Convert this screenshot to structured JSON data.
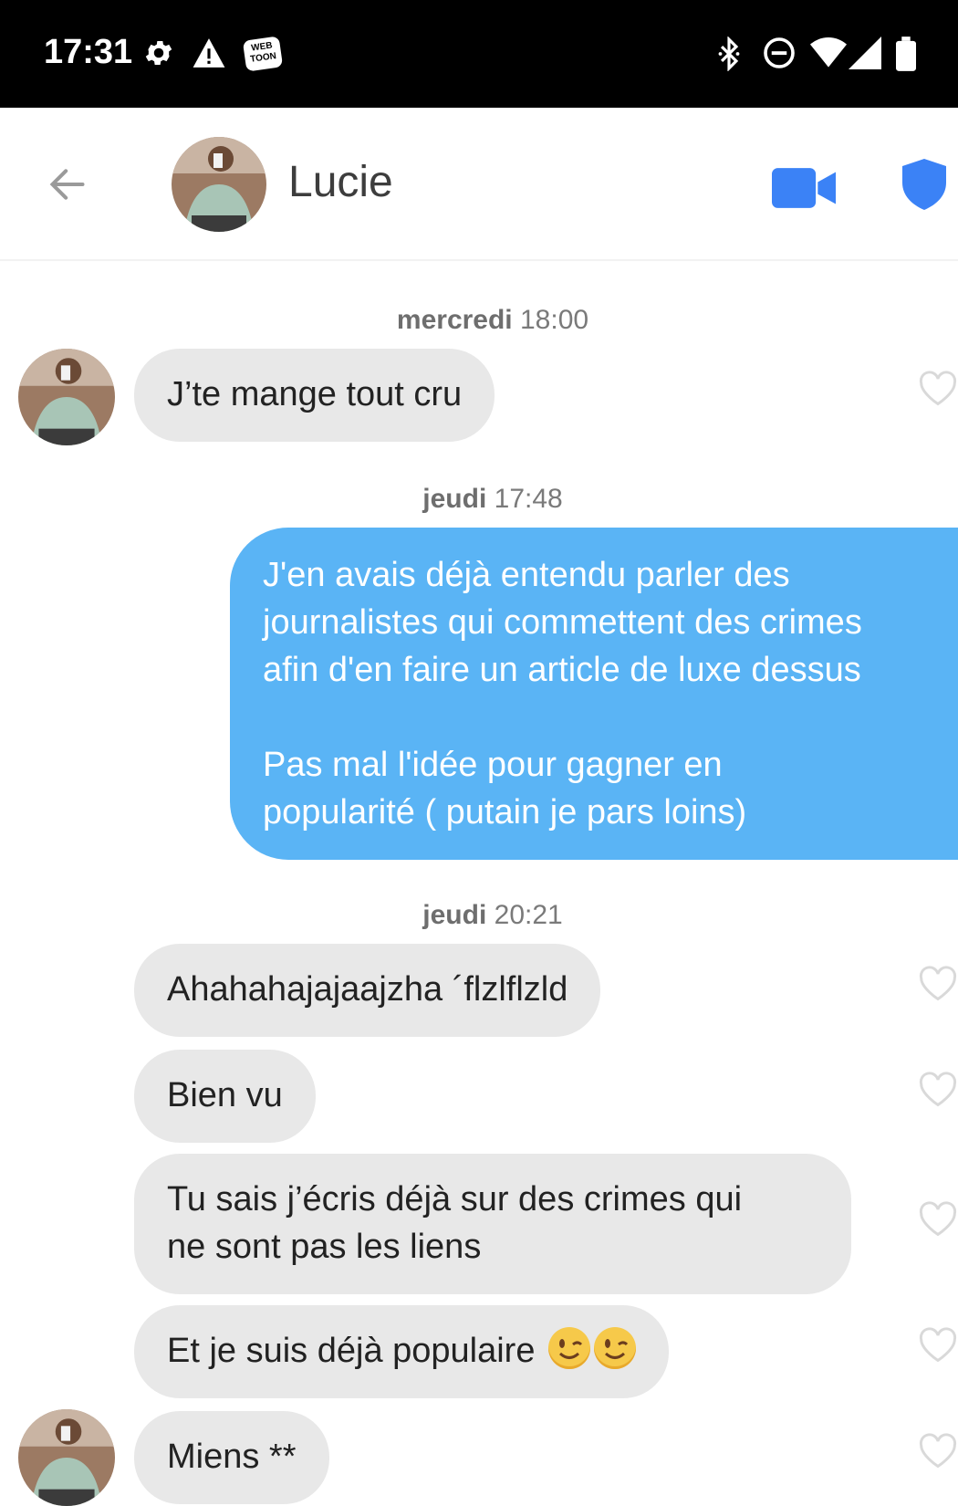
{
  "status_bar": {
    "time": "17:31",
    "left_icons": [
      "gear-icon",
      "warning-icon",
      "webtoon-icon"
    ],
    "webtoon_text": "WEB TOON",
    "right_icons": [
      "bluetooth-icon",
      "do-not-disturb-icon",
      "wifi-icon",
      "signal-icon",
      "battery-icon"
    ]
  },
  "header": {
    "contact_name": "Lucie",
    "icons": [
      "back-arrow-icon",
      "video-call-icon",
      "safety-shield-icon"
    ]
  },
  "colors": {
    "accent_blue": "#5ab4f5",
    "icon_blue": "#3b82f6",
    "incoming_bubble": "#e8e8e8"
  },
  "messages": [
    {
      "type": "timestamp",
      "day": "mercredi",
      "time": "18:00"
    },
    {
      "type": "incoming",
      "text": "J’te mange tout cru",
      "avatar": true
    },
    {
      "type": "timestamp",
      "day": "jeudi",
      "time": "17:48"
    },
    {
      "type": "outgoing",
      "lines": [
        "J'en avais déjà entendu parler des",
        "journalistes qui commettent des crimes",
        "afin d'en faire un article de luxe dessus",
        "",
        "Pas mal l'idée pour gagner en",
        "popularité ( putain je pars loins)"
      ]
    },
    {
      "type": "timestamp",
      "day": "jeudi",
      "time": "20:21"
    },
    {
      "type": "incoming",
      "text": "Ahahahajajaajzha ´flzlflzld"
    },
    {
      "type": "incoming",
      "text": "Bien vu"
    },
    {
      "type": "incoming",
      "lines": [
        "Tu sais j’écris déjà sur des crimes qui",
        "ne sont pas les liens"
      ]
    },
    {
      "type": "incoming",
      "text": "Et je suis déjà populaire",
      "emoji": [
        "winking-face-emoji",
        "winking-face-emoji"
      ]
    },
    {
      "type": "incoming",
      "text": "Miens **",
      "avatar": true
    }
  ]
}
